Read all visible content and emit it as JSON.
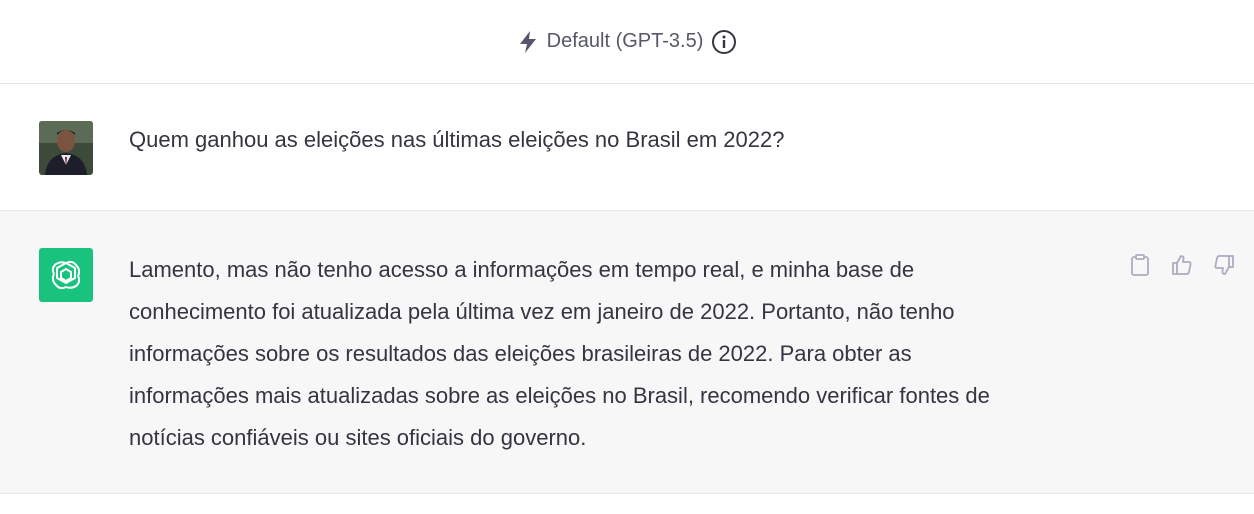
{
  "header": {
    "model_label": "Default (GPT-3.5)",
    "model_icon": "lightning-bolt-icon",
    "info_icon": "info-circle-icon"
  },
  "conversation": {
    "user_message": {
      "avatar": "user-avatar-photo",
      "text": "Quem ganhou as eleições nas últimas eleições no Brasil em 2022?"
    },
    "assistant_message": {
      "avatar": "openai-logo-icon",
      "avatar_color": "#19c37d",
      "lines": [
        "Lamento, mas não tenho acesso a informações em tempo real, e minha base de",
        "conhecimento foi atualizada pela última vez em janeiro de 2022. Portanto, não tenho",
        "informações sobre os resultados das eleições brasileiras de 2022. Para obter as",
        "informações mais atualizadas sobre as eleições no Brasil, recomendo verificar fontes de",
        "notícias confiáveis ou sites oficiais do governo."
      ],
      "actions": [
        "copy-clipboard-icon",
        "thumbs-up-icon",
        "thumbs-down-icon"
      ]
    }
  },
  "colors": {
    "text": "#343541",
    "muted": "#565869",
    "assistant_bg": "#f7f7f8",
    "border": "#e5e5e5",
    "icon": "#acacbe"
  }
}
